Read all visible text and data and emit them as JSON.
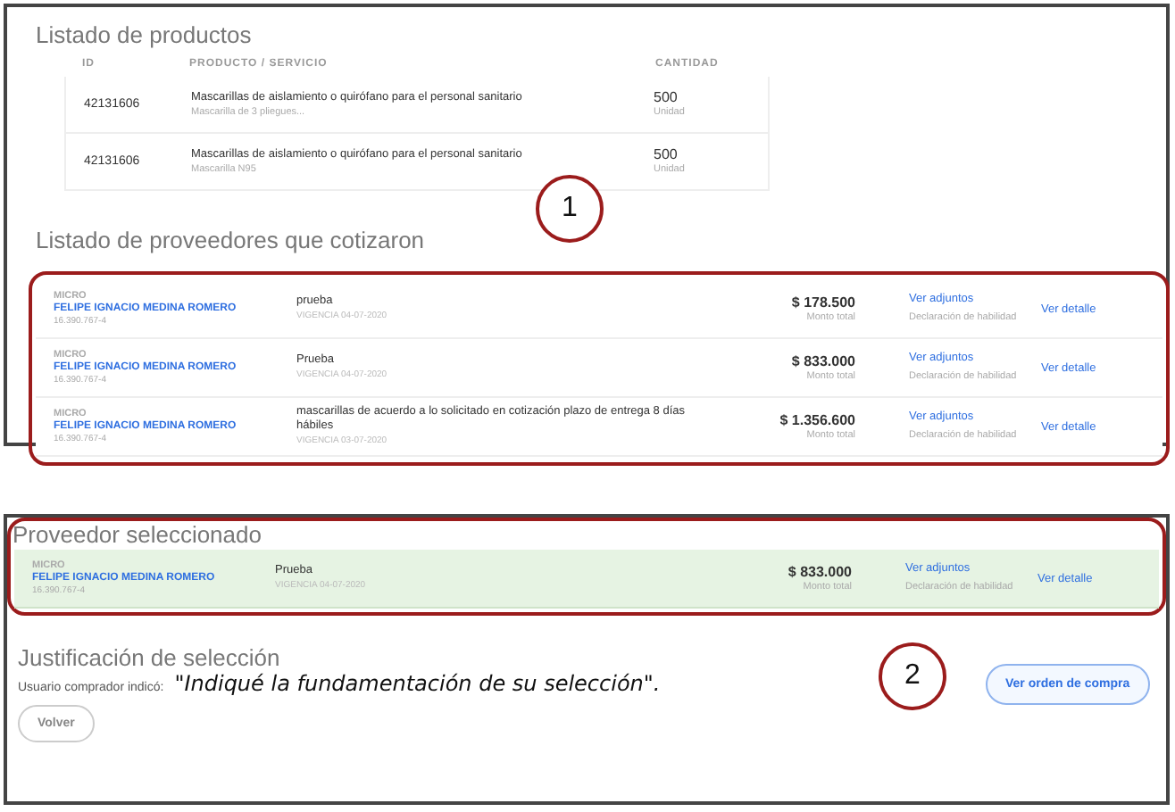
{
  "products": {
    "title": "Listado de productos",
    "columns": [
      "ID",
      "PRODUCTO / SERVICIO",
      "CANTIDAD"
    ],
    "rows": [
      {
        "id": "42131606",
        "name": "Mascarillas de aislamiento o quirófano para el personal sanitario",
        "detail": "Mascarilla de 3 pliegues...",
        "qty": "500",
        "unit": "Unidad"
      },
      {
        "id": "42131606",
        "name": "Mascarillas de aislamiento o quirófano para el personal sanitario",
        "detail": "Mascarilla N95",
        "qty": "500",
        "unit": "Unidad"
      }
    ]
  },
  "suppliers": {
    "title": "Listado de proveedores que cotizaron",
    "annotation": "1",
    "rows": [
      {
        "size": "MICRO",
        "name": "FELIPE IGNACIO MEDINA ROMERO",
        "rut": "16.390.767-4",
        "offer": "prueba",
        "validity": "VIGENCIA 04-07-2020",
        "amount": "$ 178.500",
        "amount_label": "Monto total",
        "attachments": "Ver adjuntos",
        "declaration": "Declaración de habilidad",
        "detail": "Ver detalle"
      },
      {
        "size": "MICRO",
        "name": "FELIPE IGNACIO MEDINA ROMERO",
        "rut": "16.390.767-4",
        "offer": "Prueba",
        "validity": "VIGENCIA 04-07-2020",
        "amount": "$ 833.000",
        "amount_label": "Monto total",
        "attachments": "Ver adjuntos",
        "declaration": "Declaración de habilidad",
        "detail": "Ver detalle"
      },
      {
        "size": "MICRO",
        "name": "FELIPE IGNACIO MEDINA ROMERO",
        "rut": "16.390.767-4",
        "offer": "mascarillas de acuerdo a lo solicitado en cotización plazo de entrega 8 días hábiles",
        "validity": "VIGENCIA 03-07-2020",
        "amount": "$ 1.356.600",
        "amount_label": "Monto total",
        "attachments": "Ver adjuntos",
        "declaration": "Declaración de habilidad",
        "detail": "Ver detalle"
      }
    ]
  },
  "selected": {
    "title": "Proveedor seleccionado",
    "row": {
      "size": "MICRO",
      "name": "FELIPE IGNACIO MEDINA ROMERO",
      "rut": "16.390.767-4",
      "offer": "Prueba",
      "validity": "VIGENCIA 04-07-2020",
      "amount": "$ 833.000",
      "amount_label": "Monto total",
      "attachments": "Ver adjuntos",
      "declaration": "Declaración de habilidad",
      "detail": "Ver detalle"
    }
  },
  "justification": {
    "title": "Justificación de selección",
    "label": "Usuario comprador indicó:",
    "quote": "\"Indiqué la fundamentación de su selección\".",
    "annotation": "2"
  },
  "buttons": {
    "back": "Volver",
    "order": "Ver orden de compra"
  }
}
